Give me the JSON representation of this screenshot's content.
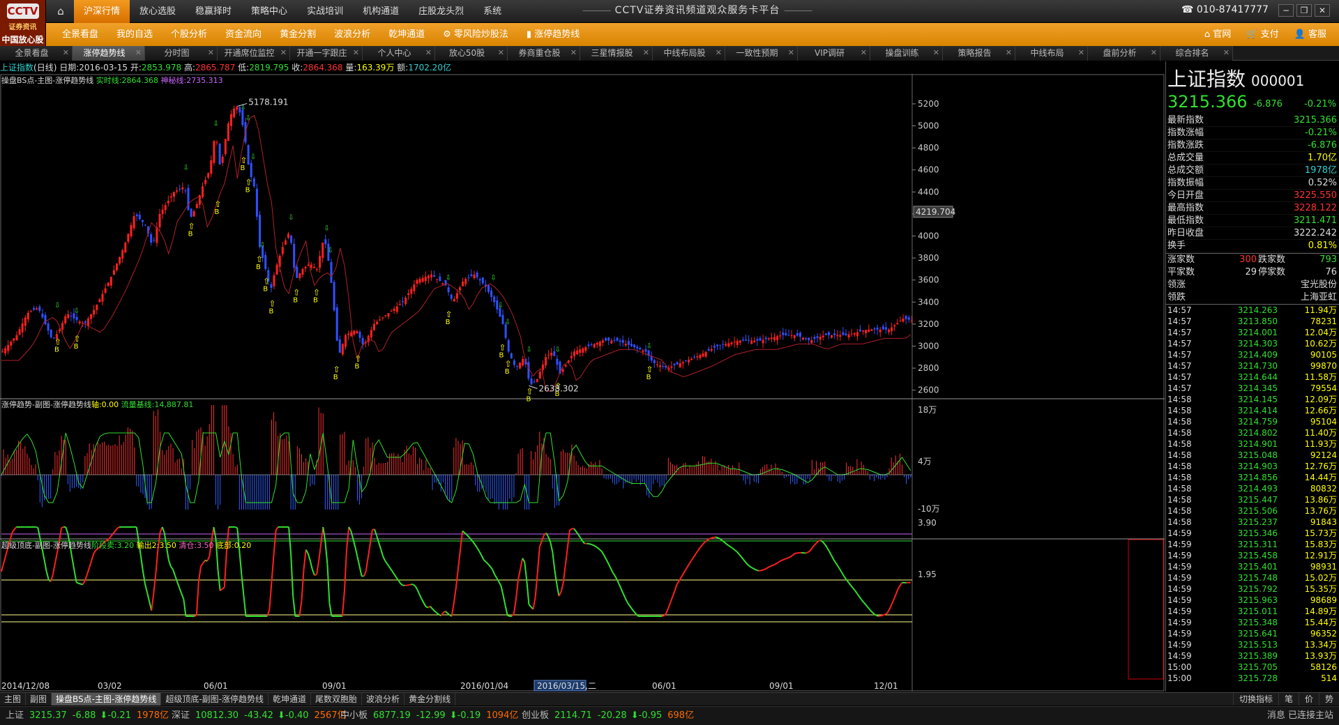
{
  "app": {
    "logo_top": "CCTV",
    "logo_mid": "证券资讯",
    "logo_bot": "中国放心股",
    "title": "CCTV证券资讯频道观众服务卡平台",
    "phone": "010-87417777"
  },
  "top_nav": [
    "沪深行情",
    "放心选股",
    "稳赢择时",
    "策略中心",
    "实战培训",
    "机构通道",
    "庄股龙头烈",
    "系统"
  ],
  "sub_nav": [
    "全景看盘",
    "我的自选",
    "个股分析",
    "资金流向",
    "黄金分割",
    "波浪分析",
    "乾坤通道",
    "零风险炒股法",
    "涨停趋势线"
  ],
  "sub_right": [
    "官网",
    "支付",
    "客服"
  ],
  "tabs": [
    "全景看盘",
    "涨停趋势线",
    "分时图",
    "开通席位监控",
    "开通一字跟庄",
    "个人中心",
    "放心50股",
    "券商重仓股",
    "三星情报股",
    "中线布局股",
    "一致性预期",
    "VIP调研",
    "操盘训练",
    "策略报告",
    "中线布局",
    "盘前分析",
    "综合排名"
  ],
  "info": {
    "name": "上证指数",
    "period": "(日线)",
    "date_label": "日期:",
    "date": "2016-03-15",
    "open_label": "开:",
    "open": "2853.978",
    "high_label": "高:",
    "high": "2865.787",
    "low_label": "低:",
    "low": "2819.795",
    "close_label": "收:",
    "close": "2864.368",
    "vol_label": "量:",
    "vol": "163.39万",
    "amt_label": "额:",
    "amt": "1702.20亿"
  },
  "chart_labels": {
    "main": "操盘BS点-主图-涨停趋势线",
    "main_l1": "实时线:2864.368",
    "main_l2": "神秘线:2735.313",
    "sub1": "涨停趋势-副图-涨停趋势线",
    "sub1_l1": "轴:0.00",
    "sub1_l2": "流量基线:14,887.81",
    "sub2": "超级顶底-副图-涨停趋势线",
    "sub2_l1": "阶段卖:3.20",
    "sub2_l2": "输出2:3.50",
    "sub2_l3": "清仓:3.50",
    "sub2_l4": "底部:0.20"
  },
  "chart_data": {
    "type": "line",
    "title": "上证指数 (日线)",
    "x_ticks": [
      "2014/12/08",
      "03/02",
      "06/01",
      "09/01",
      "2016/01/04",
      "2016/03/15,二",
      "06/01",
      "09/01",
      "12/01"
    ],
    "y_ticks_main": [
      5200,
      5000,
      4800,
      4600,
      4400,
      4200,
      4000,
      3800,
      3600,
      3400,
      3200,
      3000,
      2800,
      2600
    ],
    "ylim_main": [
      2560,
      5320
    ],
    "current_marker": "4219.704",
    "annotations": [
      "5178.191",
      "2638.302"
    ],
    "close_path": [
      [
        0,
        2950
      ],
      [
        20,
        3100
      ],
      [
        35,
        3300
      ],
      [
        50,
        3350
      ],
      [
        60,
        3200
      ],
      [
        70,
        3050
      ],
      [
        80,
        3150
      ],
      [
        90,
        3300
      ],
      [
        100,
        3250
      ],
      [
        115,
        3200
      ],
      [
        130,
        3350
      ],
      [
        150,
        3600
      ],
      [
        170,
        3900
      ],
      [
        185,
        4200
      ],
      [
        200,
        4100
      ],
      [
        210,
        3900
      ],
      [
        220,
        4200
      ],
      [
        240,
        4400
      ],
      [
        255,
        4450
      ],
      [
        262,
        4150
      ],
      [
        270,
        4250
      ],
      [
        280,
        4450
      ],
      [
        290,
        4600
      ],
      [
        298,
        4950
      ],
      [
        305,
        4600
      ],
      [
        315,
        5000
      ],
      [
        322,
        5150
      ],
      [
        330,
        5178
      ],
      [
        338,
        4950
      ],
      [
        345,
        4600
      ],
      [
        352,
        4450
      ],
      [
        360,
        3900
      ],
      [
        368,
        3700
      ],
      [
        375,
        3500
      ],
      [
        382,
        3700
      ],
      [
        392,
        3900
      ],
      [
        402,
        4050
      ],
      [
        410,
        3600
      ],
      [
        420,
        3700
      ],
      [
        430,
        3750
      ],
      [
        440,
        3700
      ],
      [
        450,
        4000
      ],
      [
        458,
        3700
      ],
      [
        466,
        3200
      ],
      [
        470,
        2900
      ],
      [
        480,
        3100
      ],
      [
        495,
        3150
      ],
      [
        505,
        3000
      ],
      [
        520,
        3200
      ],
      [
        540,
        3300
      ],
      [
        560,
        3400
      ],
      [
        580,
        3600
      ],
      [
        600,
        3650
      ],
      [
        620,
        3550
      ],
      [
        630,
        3400
      ],
      [
        645,
        3600
      ],
      [
        660,
        3650
      ],
      [
        675,
        3550
      ],
      [
        688,
        3400
      ],
      [
        700,
        3200
      ],
      [
        708,
        2950
      ],
      [
        718,
        2800
      ],
      [
        730,
        2900
      ],
      [
        738,
        2640
      ],
      [
        748,
        2700
      ],
      [
        760,
        2900
      ],
      [
        770,
        2950
      ],
      [
        780,
        2750
      ],
      [
        790,
        2850
      ],
      [
        800,
        2950
      ],
      [
        820,
        3000
      ],
      [
        840,
        3050
      ],
      [
        860,
        3050
      ],
      [
        880,
        3000
      ],
      [
        900,
        2950
      ],
      [
        910,
        2850
      ],
      [
        930,
        2800
      ],
      [
        950,
        2850
      ],
      [
        970,
        2900
      ],
      [
        1000,
        3000
      ],
      [
        1030,
        3050
      ],
      [
        1060,
        3050
      ],
      [
        1090,
        3100
      ],
      [
        1110,
        3100
      ],
      [
        1130,
        3050
      ],
      [
        1150,
        3100
      ],
      [
        1180,
        3100
      ],
      [
        1210,
        3150
      ],
      [
        1240,
        3150
      ],
      [
        1260,
        3250
      ],
      [
        1275,
        3230
      ]
    ],
    "buy_points": [
      [
        78,
        3050
      ],
      [
        105,
        3080
      ],
      [
        265,
        4100
      ],
      [
        302,
        4300
      ],
      [
        338,
        4700
      ],
      [
        345,
        4500
      ],
      [
        360,
        3800
      ],
      [
        370,
        3600
      ],
      [
        378,
        3400
      ],
      [
        412,
        3500
      ],
      [
        440,
        3500
      ],
      [
        468,
        2800
      ],
      [
        498,
        2900
      ],
      [
        625,
        3300
      ],
      [
        700,
        3000
      ],
      [
        708,
        2850
      ],
      [
        738,
        2600
      ],
      [
        778,
        2650
      ],
      [
        906,
        2800
      ]
    ],
    "sell_points": [
      [
        78,
        3350
      ],
      [
        105,
        3300
      ],
      [
        258,
        4600
      ],
      [
        300,
        5000
      ],
      [
        338,
        5150
      ],
      [
        345,
        5050
      ],
      [
        352,
        4700
      ],
      [
        365,
        3900
      ],
      [
        405,
        4150
      ],
      [
        455,
        4050
      ],
      [
        460,
        3850
      ],
      [
        625,
        3600
      ],
      [
        688,
        3600
      ],
      [
        698,
        3350
      ],
      [
        708,
        3200
      ],
      [
        738,
        2950
      ],
      [
        778,
        2950
      ],
      [
        906,
        2980
      ]
    ]
  },
  "right_panel": {
    "name": "上证指数",
    "code": "000001",
    "price": "3215.366",
    "chg": "-6.876",
    "chgp": "-0.21%",
    "stats": [
      {
        "k": "最新指数",
        "v": "3215.366",
        "c": "#30e030"
      },
      {
        "k": "指数涨幅",
        "v": "-0.21%",
        "c": "#30e030"
      },
      {
        "k": "指数涨跌",
        "v": "-6.876",
        "c": "#30e030"
      },
      {
        "k": "总成交量",
        "v": "1.70亿",
        "c": "#ffff00"
      },
      {
        "k": "总成交额",
        "v": "1978亿",
        "c": "#30d0d0"
      },
      {
        "k": "指数振幅",
        "v": "0.52%",
        "c": "#ddd"
      },
      {
        "k": "今日开盘",
        "v": "3225.550",
        "c": "#ff3030"
      },
      {
        "k": "最高指数",
        "v": "3228.122",
        "c": "#ff3030"
      },
      {
        "k": "最低指数",
        "v": "3211.471",
        "c": "#30e030"
      },
      {
        "k": "昨日收盘",
        "v": "3222.242",
        "c": "#ddd"
      },
      {
        "k": "换手",
        "v": "0.81%",
        "c": "#ffff00"
      }
    ],
    "breadth": {
      "up_label": "涨家数",
      "up": "300",
      "down_label": "跌家数",
      "down": "793",
      "flat_label": "平家数",
      "flat": "29",
      "limit_label": "停家数",
      "limit": "76",
      "lead_up_label": "领涨",
      "lead_up": "宝光股份",
      "lead_down_label": "领跌",
      "lead_down": "上海亚虹"
    },
    "ticks": [
      [
        "14:57",
        "3214.263",
        "11.94万"
      ],
      [
        "14:57",
        "3213.850",
        "78231"
      ],
      [
        "14:57",
        "3214.001",
        "12.04万"
      ],
      [
        "14:57",
        "3214.303",
        "10.62万"
      ],
      [
        "14:57",
        "3214.409",
        "90105"
      ],
      [
        "14:57",
        "3214.730",
        "99870"
      ],
      [
        "14:57",
        "3214.644",
        "11.58万"
      ],
      [
        "14:57",
        "3214.345",
        "79554"
      ],
      [
        "14:58",
        "3214.145",
        "12.09万"
      ],
      [
        "14:58",
        "3214.414",
        "12.66万"
      ],
      [
        "14:58",
        "3214.759",
        "95104"
      ],
      [
        "14:58",
        "3214.802",
        "11.40万"
      ],
      [
        "14:58",
        "3214.901",
        "11.93万"
      ],
      [
        "14:58",
        "3215.048",
        "92124"
      ],
      [
        "14:58",
        "3214.903",
        "12.76万"
      ],
      [
        "14:58",
        "3214.856",
        "14.44万"
      ],
      [
        "14:58",
        "3214.493",
        "80832"
      ],
      [
        "14:58",
        "3215.447",
        "13.86万"
      ],
      [
        "14:58",
        "3215.506",
        "13.76万"
      ],
      [
        "14:58",
        "3215.237",
        "91843"
      ],
      [
        "14:59",
        "3215.346",
        "15.73万"
      ],
      [
        "14:59",
        "3215.311",
        "15.83万"
      ],
      [
        "14:59",
        "3215.458",
        "12.91万"
      ],
      [
        "14:59",
        "3215.401",
        "98931"
      ],
      [
        "14:59",
        "3215.748",
        "15.02万"
      ],
      [
        "14:59",
        "3215.792",
        "15.35万"
      ],
      [
        "14:59",
        "3215.963",
        "98689"
      ],
      [
        "14:59",
        "3215.011",
        "14.89万"
      ],
      [
        "14:59",
        "3215.348",
        "15.44万"
      ],
      [
        "14:59",
        "3215.641",
        "96352"
      ],
      [
        "14:59",
        "3215.513",
        "13.34万"
      ],
      [
        "14:59",
        "3215.389",
        "13.93万"
      ],
      [
        "15:00",
        "3215.705",
        "58126"
      ],
      [
        "15:00",
        "3215.728",
        "514"
      ]
    ]
  },
  "sub1_axis": [
    "18万",
    "4万",
    "-10万"
  ],
  "sub2_axis": [
    "3.90",
    "1.95"
  ],
  "bottom_tabs": [
    "主图",
    "副图",
    "操盘BS点-主图-涨停趋势线",
    "超级顶底-副图-涨停趋势线",
    "乾坤通道",
    "尾数双胞胎",
    "波浪分析",
    "黄金分割线"
  ],
  "bottom_right": [
    "切换指标",
    "笔",
    "价",
    "势"
  ],
  "status": [
    {
      "name": "上证",
      "price": "3215.37",
      "chg": "-6.88",
      "pct": "-0.21",
      "amt": "1978亿"
    },
    {
      "name": "深证",
      "price": "10812.30",
      "chg": "-43.42",
      "pct": "-0.40",
      "amt": "2567亿"
    },
    {
      "name": "中小板",
      "price": "6877.19",
      "chg": "-12.99",
      "pct": "-0.19",
      "amt": "1094亿"
    },
    {
      "name": "创业板",
      "price": "2114.71",
      "chg": "-20.28",
      "pct": "-0.95",
      "amt": "698亿"
    }
  ],
  "status_right": "消息   已连接主站"
}
